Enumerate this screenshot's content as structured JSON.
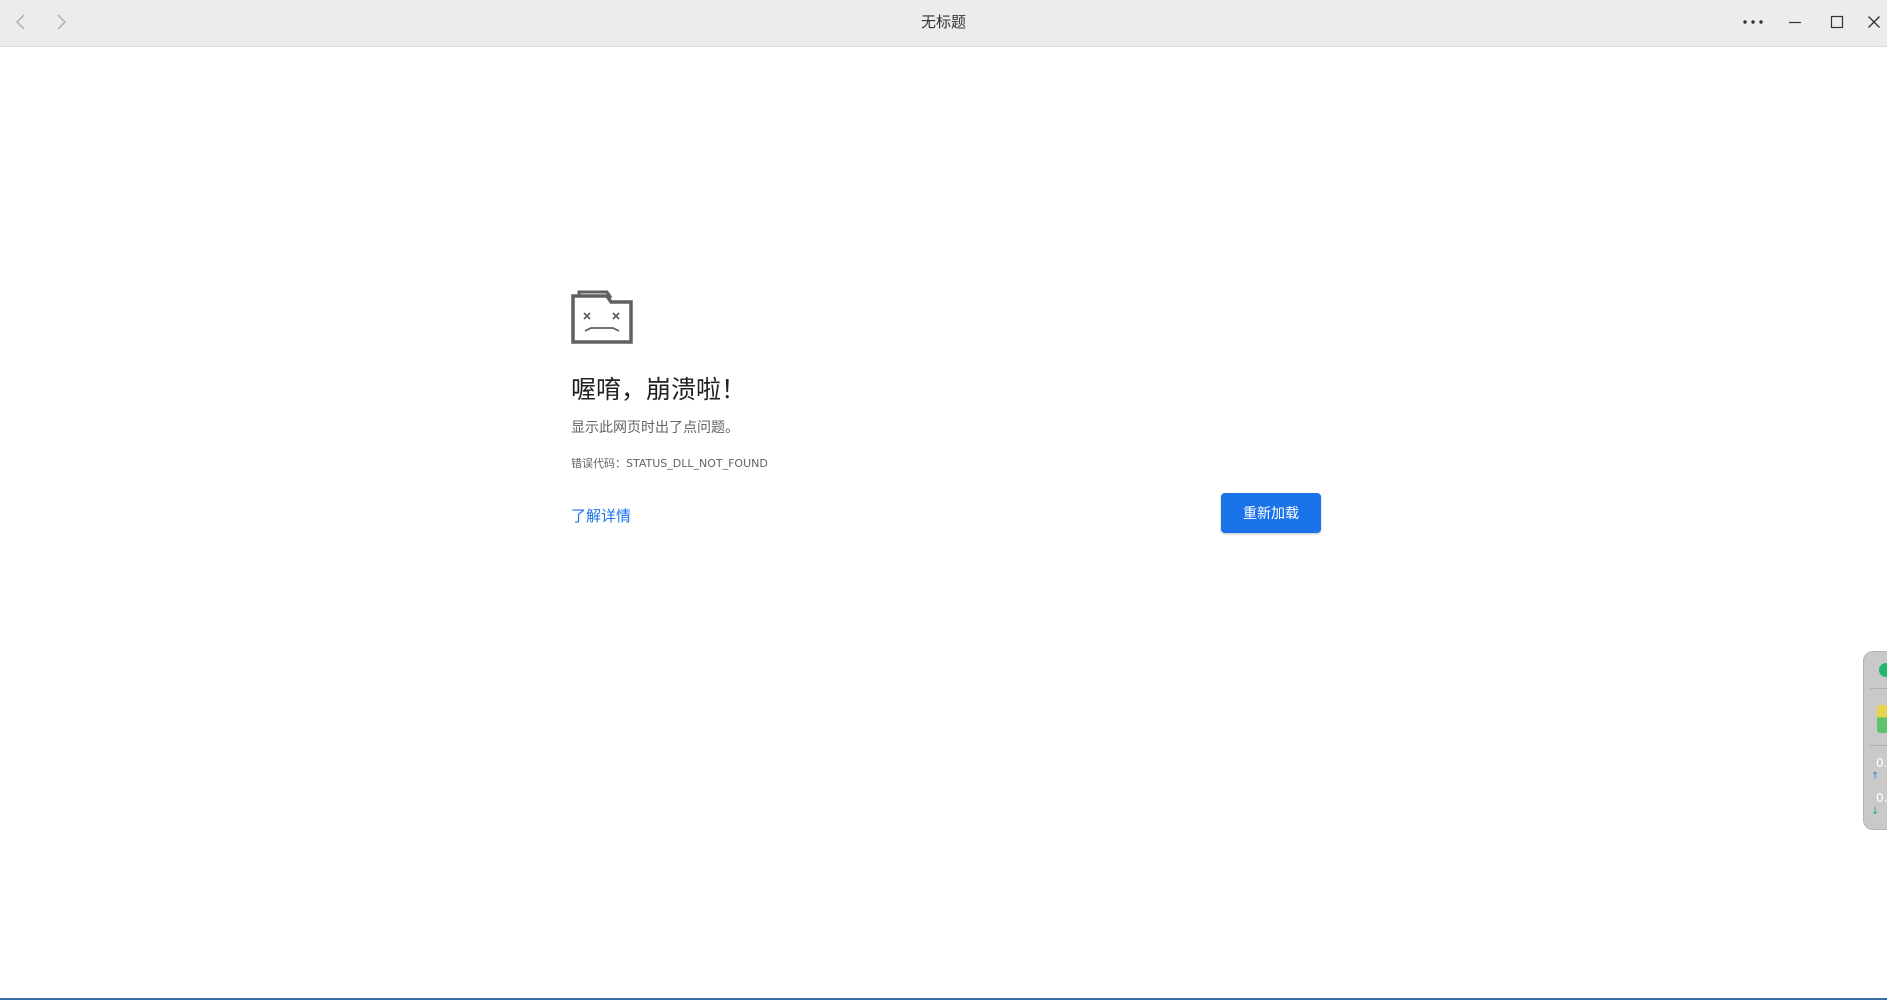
{
  "window": {
    "title": "无标题"
  },
  "titlebar": {
    "icons": {
      "back": "chevron-left-icon",
      "forward": "chevron-right-icon",
      "more": "more-horizontal-icon",
      "minimize": "minimize-icon",
      "maximize": "maximize-icon",
      "close": "close-icon"
    }
  },
  "crash": {
    "icon": "sad-folder-icon",
    "title": "喔唷，崩溃啦！",
    "description": "显示此网页时出了点问题。",
    "error_code": "错误代码：STATUS_DLL_NOT_FOUND",
    "learn_more_label": "了解详情",
    "reload_label": "重新加载"
  },
  "side_widget": {
    "upload_value": "0.",
    "download_value": "0."
  },
  "colors": {
    "accent": "#1a73e8",
    "titlebar_bg": "#ececec",
    "widget_green": "#1fb86e"
  }
}
